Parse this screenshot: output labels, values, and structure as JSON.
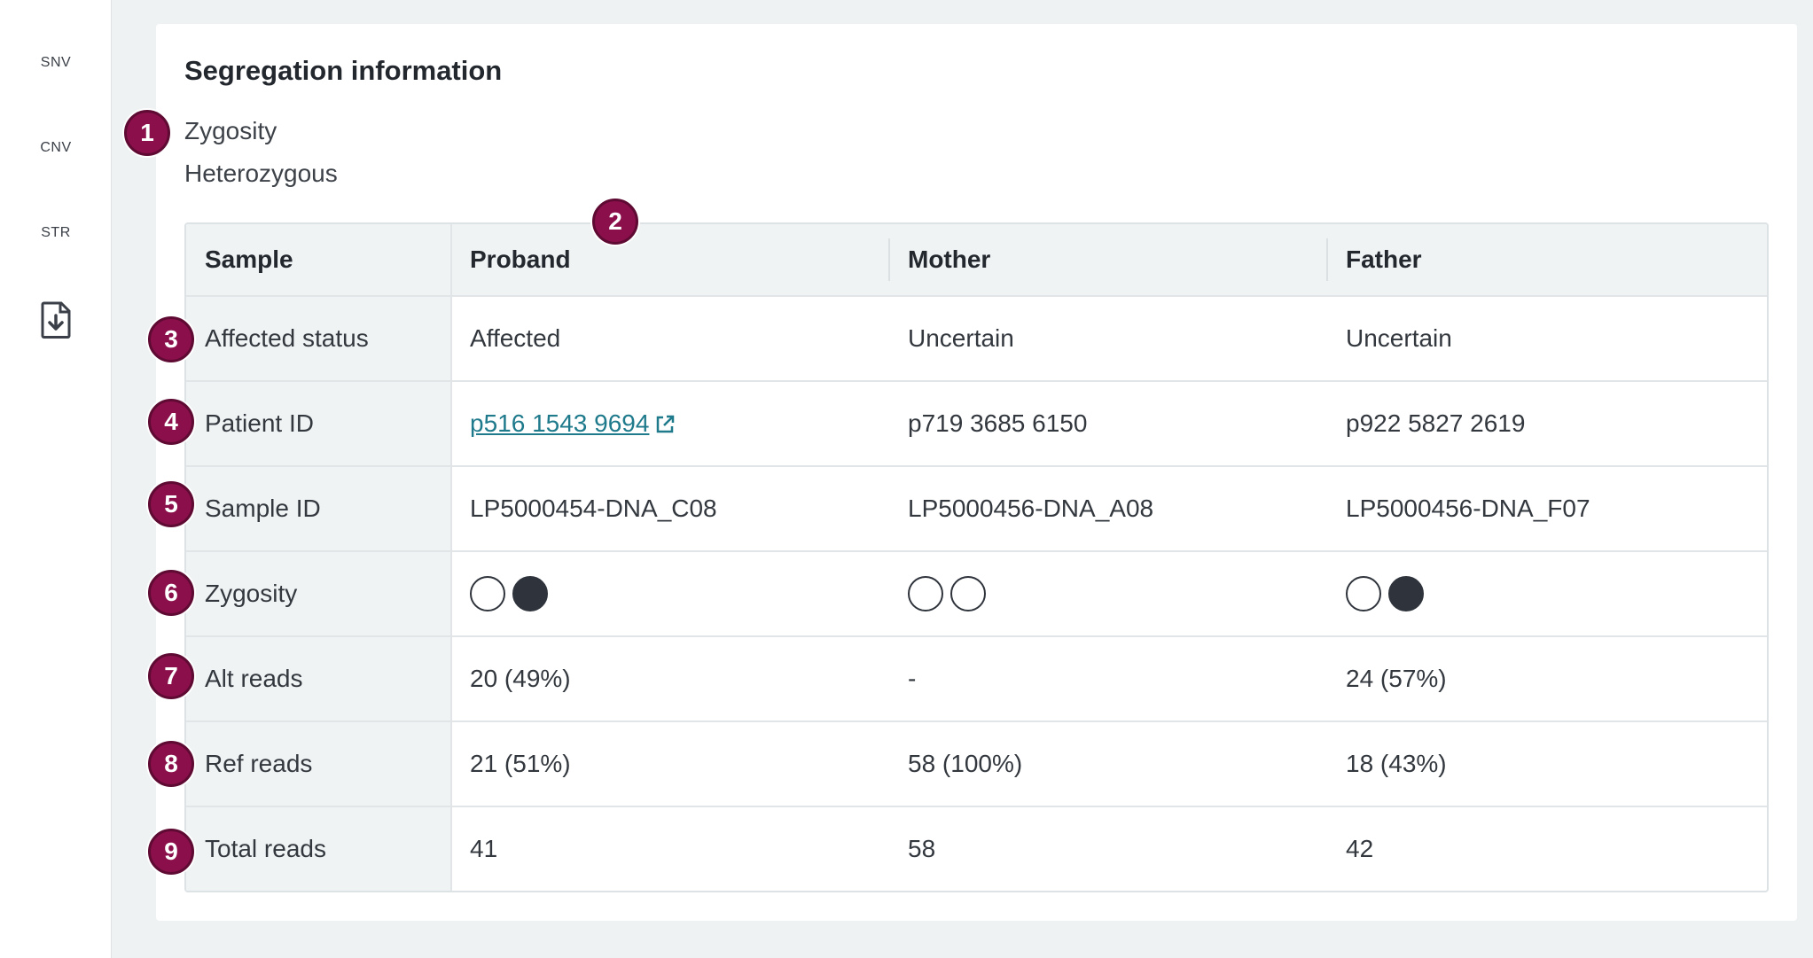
{
  "sidebar": {
    "items": [
      {
        "label": "SNV"
      },
      {
        "label": "CNV"
      },
      {
        "label": "STR"
      }
    ],
    "download_icon": "file-download-icon"
  },
  "card": {
    "title": "Segregation information",
    "zygosity_label": "Zygosity",
    "zygosity_value": "Heterozygous"
  },
  "table": {
    "headers": [
      "Sample",
      "Proband",
      "Mother",
      "Father"
    ],
    "rows": {
      "affected": {
        "label": "Affected status",
        "proband": "Affected",
        "mother": "Uncertain",
        "father": "Uncertain"
      },
      "patient": {
        "label": "Patient ID",
        "proband": "p516 1543 9694",
        "mother": "p719 3685 6150",
        "father": "p922 5827 2619"
      },
      "sample": {
        "label": "Sample ID",
        "proband": "LP5000454-DNA_C08",
        "mother": "LP5000456-DNA_A08",
        "father": "LP5000456-DNA_F07"
      },
      "zygosity": {
        "label": "Zygosity",
        "proband": [
          "empty",
          "filled"
        ],
        "mother": [
          "empty",
          "empty"
        ],
        "father": [
          "empty",
          "filled"
        ]
      },
      "alt": {
        "label": "Alt reads",
        "proband": "20 (49%)",
        "mother": "-",
        "father": "24 (57%)"
      },
      "ref": {
        "label": "Ref reads",
        "proband": "21 (51%)",
        "mother": "58 (100%)",
        "father": "18 (43%)"
      },
      "total": {
        "label": "Total reads",
        "proband": "41",
        "mother": "58",
        "father": "42"
      }
    }
  },
  "markers": [
    "1",
    "2",
    "3",
    "4",
    "5",
    "6",
    "7",
    "8",
    "9"
  ],
  "colors": {
    "marker": "#8a0f4a",
    "link": "#1f7a8c",
    "background": "#eff2f3"
  }
}
